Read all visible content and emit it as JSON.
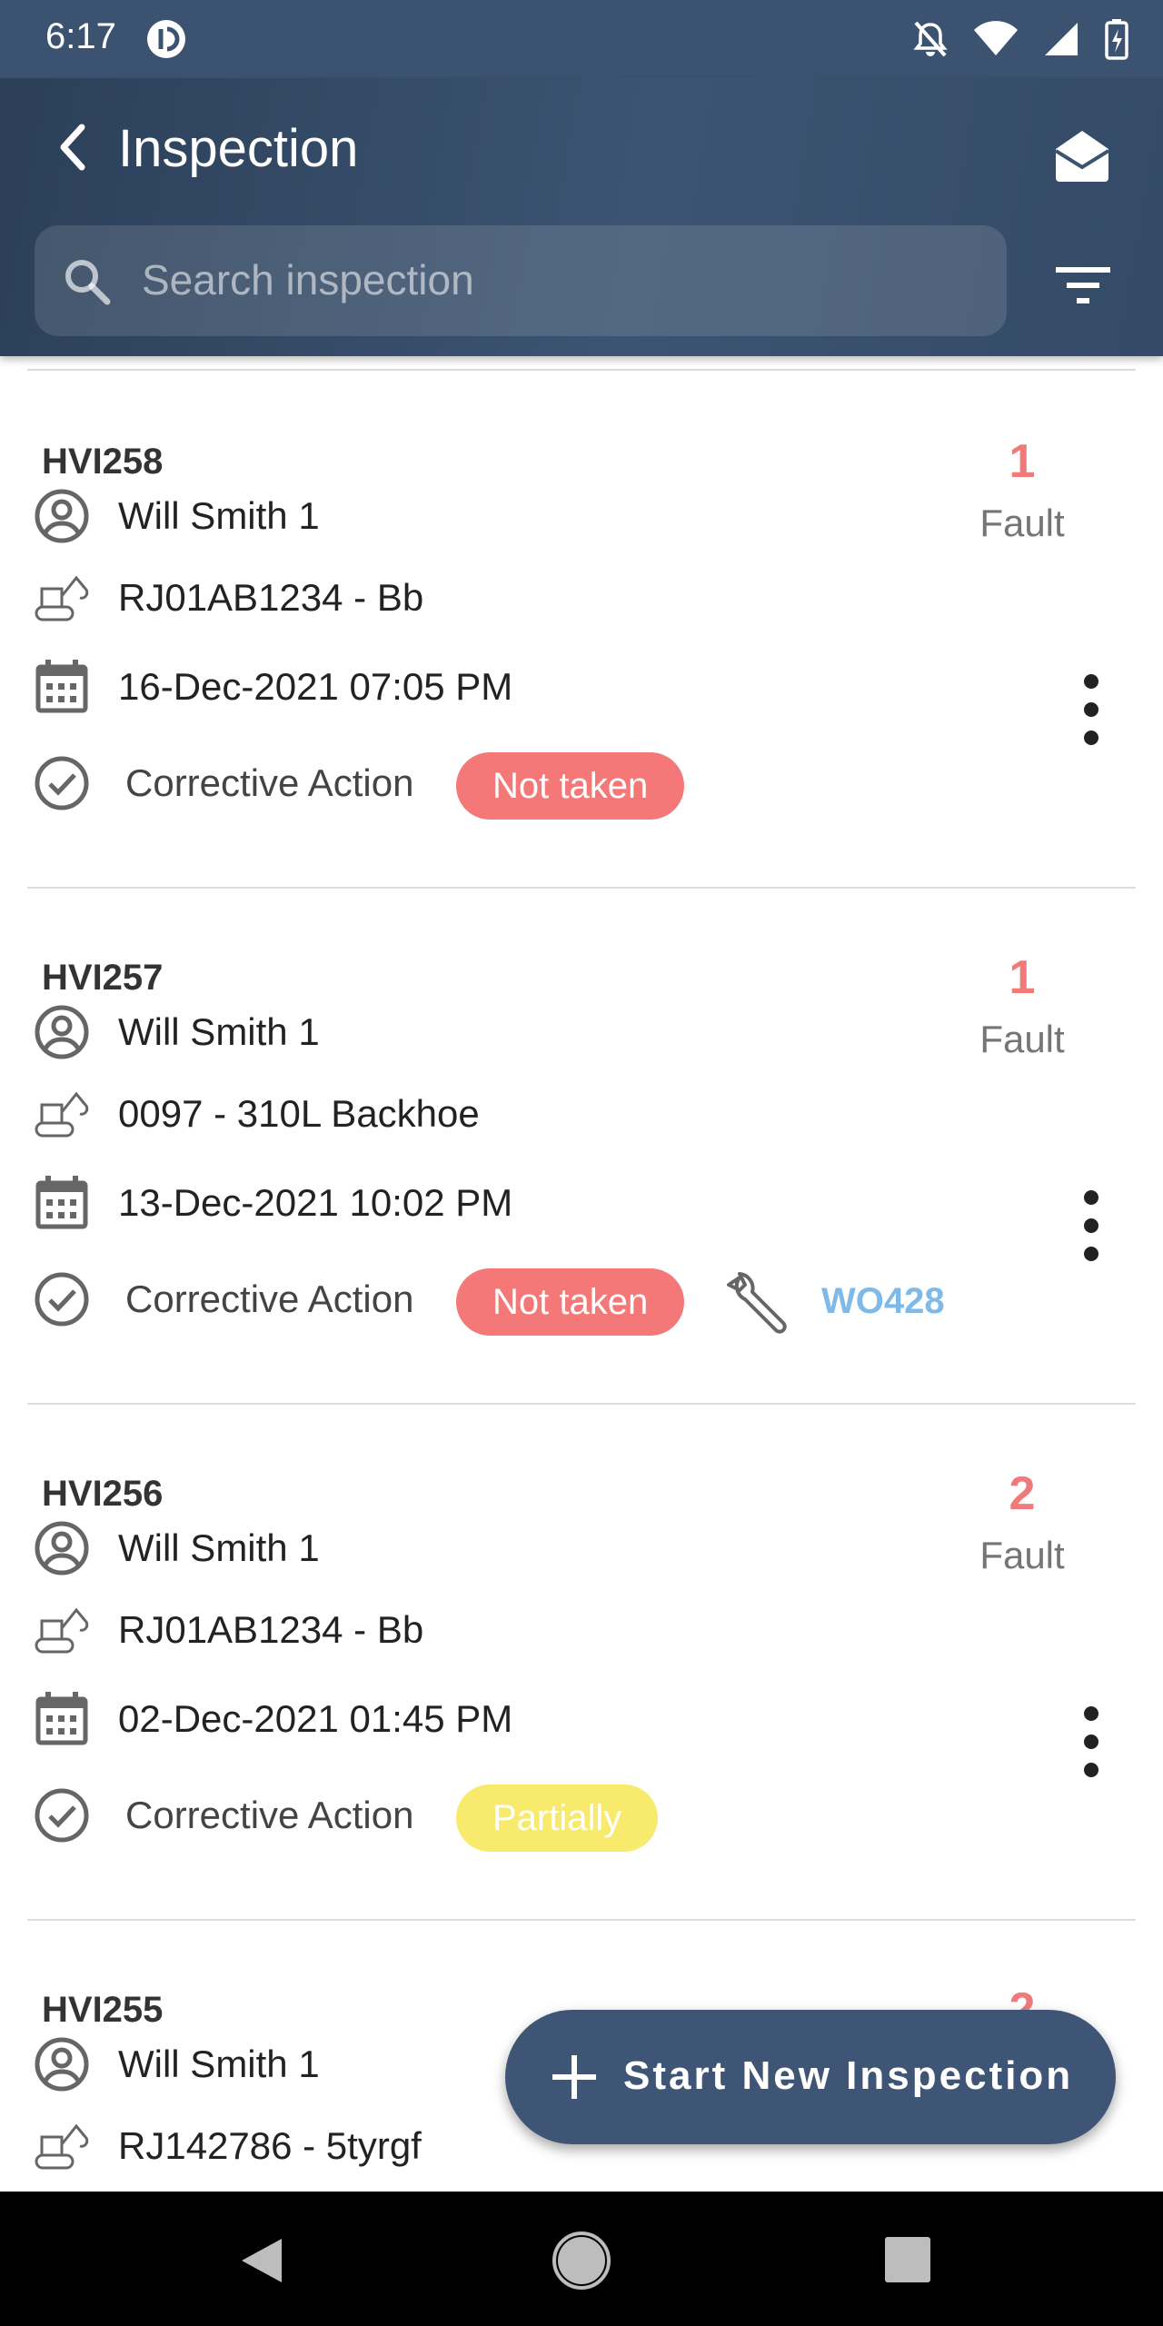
{
  "status_bar": {
    "time": "6:17"
  },
  "header": {
    "title": "Inspection",
    "search_placeholder": "Search inspection"
  },
  "inspections": [
    {
      "id": "HVI258",
      "fault_count": "1",
      "fault_label": "Fault",
      "user": "Will Smith 1",
      "vehicle": "RJ01AB1234 - Bb",
      "date": "16-Dec-2021 07:05 PM",
      "action_label": "Corrective Action",
      "status": "Not taken",
      "status_color": "#f47878"
    },
    {
      "id": "HVI257",
      "fault_count": "1",
      "fault_label": "Fault",
      "user": "Will Smith 1",
      "vehicle": "0097 - 310L Backhoe",
      "date": "13-Dec-2021 10:02 PM",
      "action_label": "Corrective Action",
      "status": "Not taken",
      "status_color": "#f47878",
      "work_order": "WO428"
    },
    {
      "id": "HVI256",
      "fault_count": "2",
      "fault_label": "Fault",
      "user": "Will Smith 1",
      "vehicle": "RJ01AB1234 - Bb",
      "date": "02-Dec-2021 01:45 PM",
      "action_label": "Corrective Action",
      "status": "Partially",
      "status_color": "#f7ea6c"
    },
    {
      "id": "HVI255",
      "fault_count": "2",
      "user": "Will Smith 1",
      "vehicle": "RJ142786 - 5tyrgf"
    }
  ],
  "fab": {
    "label": "Start New Inspection"
  },
  "colors": {
    "header": "#3c5472",
    "fault": "#f07a7a",
    "link": "#7eb9e8"
  }
}
